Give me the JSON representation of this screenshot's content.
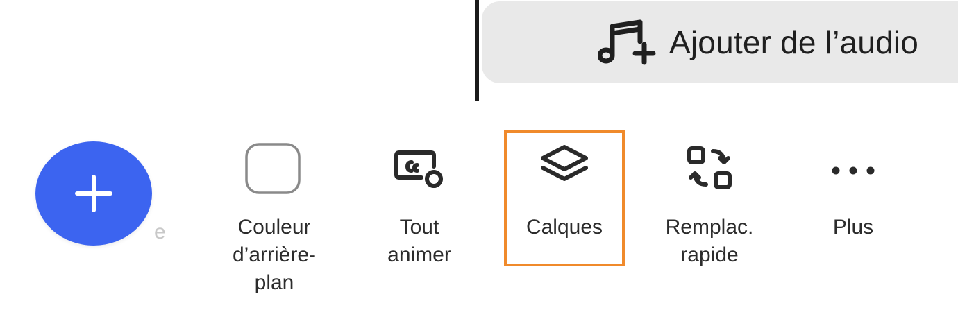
{
  "audio_button": {
    "label": "Ajouter de l’audio",
    "icon": "music-note-plus-icon"
  },
  "fab": {
    "icon": "plus-icon",
    "color": "#3c64f0"
  },
  "faded_text": "e",
  "toolbar": {
    "items": [
      {
        "label": "Couleur\nd’arrière-\nplan",
        "icon": "rounded-square-icon"
      },
      {
        "label": "Tout\nanimer",
        "icon": "animate-icon"
      },
      {
        "label": "Calques",
        "icon": "layers-icon",
        "selected": true
      },
      {
        "label": "Remplac.\nrapide",
        "icon": "swap-icon"
      },
      {
        "label": "Plus",
        "icon": "more-dots-icon"
      }
    ]
  },
  "colors": {
    "highlight": "#f08a2b",
    "fab": "#3c64f0",
    "pill": "#e9e9e9"
  }
}
